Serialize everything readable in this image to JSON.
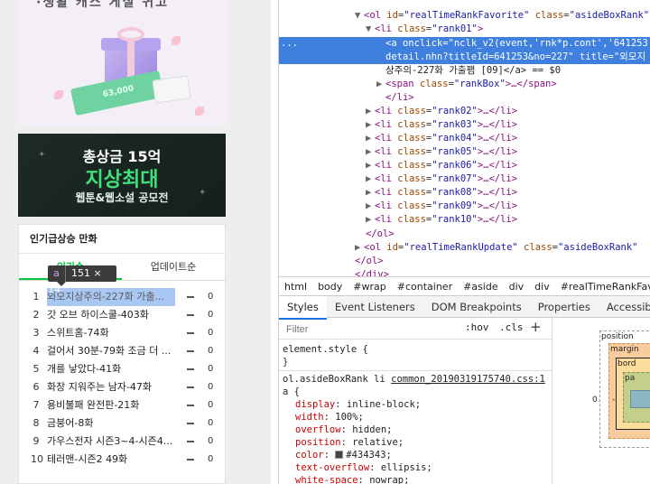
{
  "left": {
    "banner1": {
      "top_text": "·생활 캐스 게실 귀고",
      "card_value": "63,000"
    },
    "banner2": {
      "line1": "총상금 15억",
      "line2": "지상최대",
      "line3": "웹툰&웹소설 공모전"
    },
    "rank_section": {
      "title": "인기급상승 만화",
      "tabs": [
        {
          "label": "인기순"
        },
        {
          "label": "업데이트순"
        }
      ],
      "tooltip": {
        "tag": "a",
        "size": "151 × 14"
      },
      "items": [
        {
          "rank": "1",
          "title": "외모지상주의-227화 가출...",
          "count": "0"
        },
        {
          "rank": "2",
          "title": "갓 오브 하이스쿨-403화",
          "count": "0"
        },
        {
          "rank": "3",
          "title": "스위트홈-74화",
          "count": "0"
        },
        {
          "rank": "4",
          "title": "걸어서 30분-79화 조금 더 ...",
          "count": "0"
        },
        {
          "rank": "5",
          "title": "개를 낳았다-41화",
          "count": "0"
        },
        {
          "rank": "6",
          "title": "화장 지워주는 남자-47화",
          "count": "0"
        },
        {
          "rank": "7",
          "title": "용비불패 완전판-21화",
          "count": "0"
        },
        {
          "rank": "8",
          "title": "금붕어-8화",
          "count": "0"
        },
        {
          "rank": "9",
          "title": "가우스전자 시즌3~4-시즌4...",
          "count": "0"
        },
        {
          "rank": "10",
          "title": "테러맨-시즌2 49화",
          "count": "0"
        }
      ]
    }
  },
  "devtools": {
    "elements": {
      "l1": {
        "tag_open": "<ol",
        "a1": "id",
        "v1": "\"realTimeRankFavorite\"",
        "a2": "class",
        "v2": "\"asideBoxRank\""
      },
      "l2": {
        "tag_open": "<li",
        "a1": "class",
        "v1": "\"rank01\"",
        "tag_close": ">"
      },
      "l3": {
        "dots": "...",
        "text": "<a onclick=\"nclk_v2(event,'rnk*p.cont','641253"
      },
      "l4": {
        "text": "detail.nhn?titleId=641253&no=227\" title=\"외모지"
      },
      "l5": {
        "text": "상주의-227화 가출팸 [09]</a> == $0"
      },
      "l6": {
        "tag_open": "<span",
        "a1": "class",
        "v1": "\"rankBox\"",
        "rest": ">…</span>"
      },
      "l7": {
        "text": "</li>"
      },
      "ranks": [
        {
          "cls": "\"rank02\""
        },
        {
          "cls": "\"rank03\""
        },
        {
          "cls": "\"rank04\""
        },
        {
          "cls": "\"rank05\""
        },
        {
          "cls": "\"rank06\""
        },
        {
          "cls": "\"rank07\""
        },
        {
          "cls": "\"rank08\""
        },
        {
          "cls": "\"rank09\""
        },
        {
          "cls": "\"rank10\""
        }
      ],
      "li_tag": "<li",
      "li_attr": "class",
      "li_rest": ">…</li>",
      "ol_close": "</ol>",
      "l_ol2": {
        "tag_open": "<ol",
        "a1": "id",
        "v1": "\"realTimeRankUpdate\"",
        "a2": "class",
        "v2": "\"asideBoxRank\""
      },
      "ol_close2": "</ol>",
      "div_close": "</div>"
    },
    "breadcrumbs": [
      "html",
      "body",
      "#wrap",
      "#container",
      "#aside",
      "div",
      "div",
      "#realTimeRankFav"
    ],
    "panel_tabs": [
      "Styles",
      "Event Listeners",
      "DOM Breakpoints",
      "Properties",
      "Accessibility"
    ],
    "filter": {
      "placeholder": "Filter",
      "hov": ":hov",
      "cls": ".cls",
      "plus": "+"
    },
    "styles": {
      "element_style": "element.style {",
      "close": "}",
      "rule_selector": "ol.asideBoxRank li",
      "rule_source": "common_20190319175740.css:1",
      "rule_selector2": "a {",
      "props": [
        {
          "name": "display",
          "value": "inline-block;"
        },
        {
          "name": "width",
          "value": "100%;"
        },
        {
          "name": "overflow",
          "value": "hidden;"
        },
        {
          "name": "position",
          "value": "relative;"
        },
        {
          "name": "color",
          "value": "#434343;"
        },
        {
          "name": "text-overflow",
          "value": "ellipsis;"
        },
        {
          "name": "white-space",
          "value": "nowrap;"
        }
      ]
    },
    "boxmodel": {
      "position": "position",
      "margin": "margin",
      "border": "bord",
      "padding": "pa",
      "left_value": "0",
      "dash": "-"
    }
  }
}
